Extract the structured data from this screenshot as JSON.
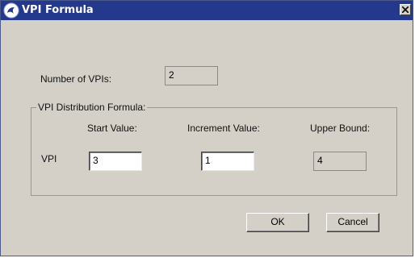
{
  "window": {
    "title": "VPI Formula"
  },
  "number_of_vpis": {
    "label": "Number of VPIs:",
    "value": "2"
  },
  "distribution": {
    "group_label": "VPI Distribution Formula:",
    "start_header": "Start Value:",
    "increment_header": "Increment Value:",
    "upper_header": "Upper Bound:",
    "row_label": "VPI",
    "start_value": "3",
    "increment_value": "1",
    "upper_value": "4"
  },
  "buttons": {
    "ok": "OK",
    "cancel": "Cancel"
  },
  "icons": {
    "title": "app-logo-icon",
    "close": "close-icon"
  },
  "colors": {
    "titlebar": "#24398c",
    "dialog_bg": "#d4d0c8"
  }
}
